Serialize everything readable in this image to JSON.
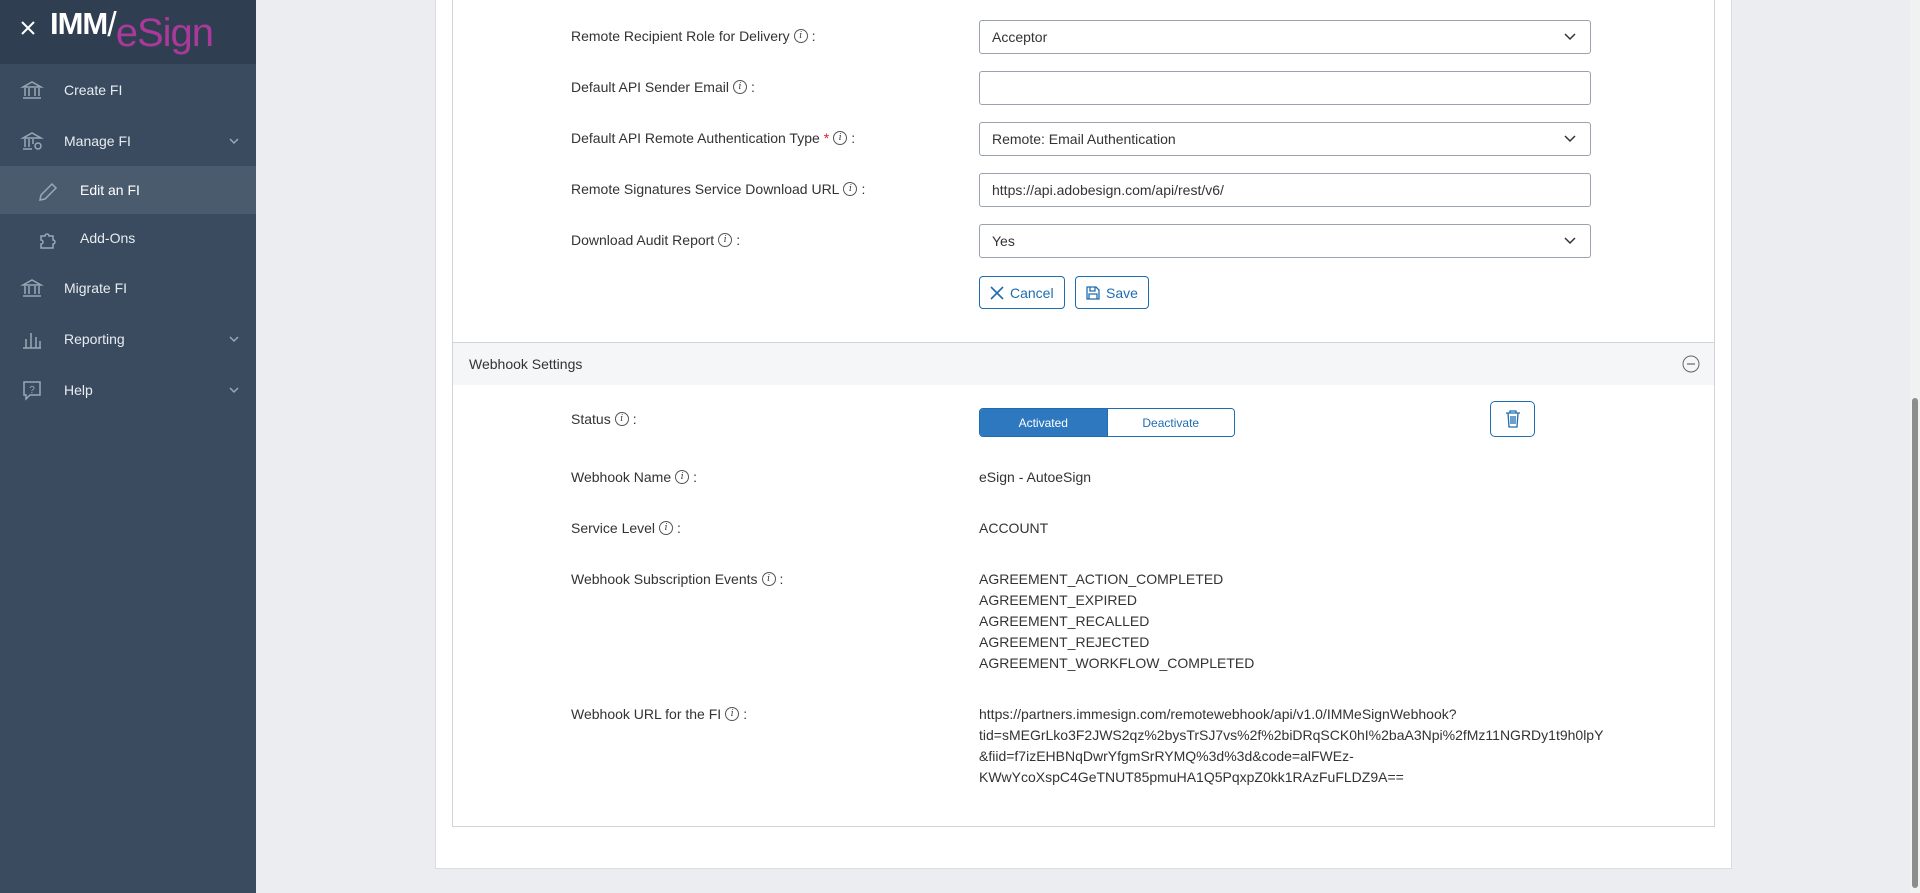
{
  "brand": {
    "imm": "IMM",
    "esign": "eSign"
  },
  "sidebar": {
    "items": [
      {
        "label": "Create FI",
        "icon": "bank-icon"
      },
      {
        "label": "Manage FI",
        "icon": "bank-settings-icon"
      },
      {
        "label": "Edit an FI",
        "icon": "pencil-icon"
      },
      {
        "label": "Add-Ons",
        "icon": "puzzle-icon"
      },
      {
        "label": "Migrate FI",
        "icon": "bank-icon"
      },
      {
        "label": "Reporting",
        "icon": "bar-chart-icon"
      },
      {
        "label": "Help",
        "icon": "help-icon"
      }
    ]
  },
  "form": {
    "recipient_role": {
      "label": "Remote Recipient Role for Delivery",
      "value": "Acceptor"
    },
    "sender_email": {
      "label": "Default API Sender Email",
      "value": ""
    },
    "auth_type": {
      "label": "Default API Remote Authentication Type",
      "value": "Remote: Email Authentication"
    },
    "download_url": {
      "label": "Remote Signatures Service Download URL",
      "value": "https://api.adobesign.com/api/rest/v6/"
    },
    "audit_report": {
      "label": "Download Audit Report",
      "value": "Yes"
    },
    "cancel_label": "Cancel",
    "save_label": "Save"
  },
  "webhook": {
    "header": "Webhook Settings",
    "status_label": "Status",
    "activated": "Activated",
    "deactivate": "Deactivate",
    "name_label": "Webhook Name",
    "name_value": "eSign - AutoeSign",
    "service_label": "Service Level",
    "service_value": "ACCOUNT",
    "events_label": "Webhook Subscription Events",
    "events": [
      "AGREEMENT_ACTION_COMPLETED",
      "AGREEMENT_EXPIRED",
      "AGREEMENT_RECALLED",
      "AGREEMENT_REJECTED",
      "AGREEMENT_WORKFLOW_COMPLETED"
    ],
    "url_label": "Webhook URL for the FI",
    "url_lines": [
      "https://partners.immesign.com/remotewebhook/api/v1.0/IMMeSignWebhook?",
      "tid=sMEGrLko3F2JWS2qz%2bysTrSJ7vs%2f%2biDRqSCK0hI%2baA3Npi%2fMz11NGRDy1t9h0lpY",
      "&fiid=f7izEHBNqDwrYfgmSrRYMQ%3d%3d&code=alFWEz-",
      "KWwYcoXspC4GeTNUT85pmuHA1Q5PqxpZ0kk1RAzFuFLDZ9A=="
    ]
  },
  "colors": {
    "sidebar": "#3b4b5f",
    "accent": "#1e6db1",
    "brand_magenta": "#a93a99"
  }
}
